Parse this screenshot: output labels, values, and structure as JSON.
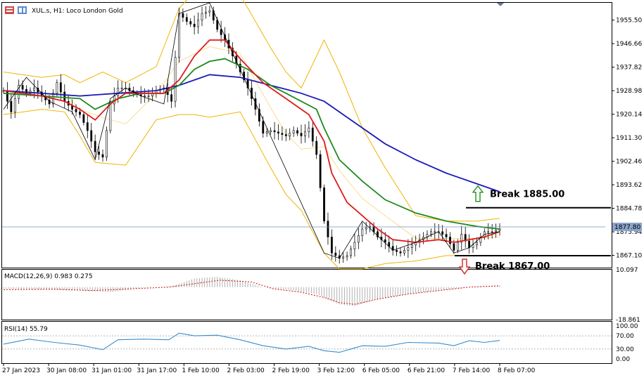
{
  "header": {
    "symbol_text": "XUL.s, H1:  Loco London Gold",
    "colors": {
      "candle_up": "#000000",
      "candle_down": "#000000",
      "ma_blue": "#1a1ab8",
      "ma_green": "#1e8a1e",
      "ma_red": "#e01a1a",
      "bollinger": "#f0b400",
      "zigzag": "#000000",
      "current_price_line": "#7090c0",
      "macd_hist": "#b0b0b0",
      "macd_signal": "#d01010",
      "rsi": "#3a8ccc"
    }
  },
  "chart_data": [
    {
      "type": "line",
      "panel": "price",
      "ylim": [
        1862.5,
        1962.0
      ],
      "y_ticks": [
        "1955.50",
        "1946.66",
        "1937.82",
        "1928.98",
        "1920.14",
        "1911.30",
        "1902.46",
        "1893.62",
        "1884.78",
        "1875.94",
        "1867.10"
      ],
      "current_price": "1877.80",
      "x_tick_labels": [
        "27 Jan 2023",
        "30 Jan 08:00",
        "31 Jan 01:00",
        "31 Jan 17:00",
        "1 Feb 10:00",
        "2 Feb 03:00",
        "2 Feb 19:00",
        "3 Feb 12:00",
        "6 Feb 05:00",
        "6 Feb 21:00",
        "7 Feb 14:00",
        "8 Feb 07:00"
      ],
      "close_path": [
        [
          0,
          1929
        ],
        [
          6,
          1921
        ],
        [
          12,
          1931
        ],
        [
          18,
          1928
        ],
        [
          24,
          1930
        ],
        [
          30,
          1927
        ],
        [
          36,
          1924
        ],
        [
          42,
          1932
        ],
        [
          48,
          1925
        ],
        [
          54,
          1922
        ],
        [
          60,
          1920
        ],
        [
          66,
          1914
        ],
        [
          72,
          1906
        ],
        [
          78,
          1904
        ],
        [
          84,
          1924
        ],
        [
          90,
          1930
        ],
        [
          96,
          1930
        ],
        [
          102,
          1928
        ],
        [
          108,
          1927
        ],
        [
          114,
          1927
        ],
        [
          120,
          1929
        ],
        [
          126,
          1930
        ],
        [
          132,
          1925
        ],
        [
          138,
          1958
        ],
        [
          144,
          1955
        ],
        [
          150,
          1953
        ],
        [
          156,
          1958
        ],
        [
          162,
          1959
        ],
        [
          168,
          1952
        ],
        [
          174,
          1948
        ],
        [
          180,
          1942
        ],
        [
          186,
          1936
        ],
        [
          192,
          1930
        ],
        [
          198,
          1922
        ],
        [
          204,
          1913
        ],
        [
          210,
          1914
        ],
        [
          216,
          1913
        ],
        [
          222,
          1912
        ],
        [
          228,
          1914
        ],
        [
          234,
          1912
        ],
        [
          240,
          1915
        ],
        [
          246,
          1905
        ],
        [
          252,
          1880
        ],
        [
          258,
          1868
        ],
        [
          264,
          1866
        ],
        [
          270,
          1867
        ],
        [
          276,
          1872
        ],
        [
          282,
          1877
        ],
        [
          288,
          1878
        ],
        [
          294,
          1874
        ],
        [
          300,
          1872
        ],
        [
          306,
          1869
        ],
        [
          312,
          1868
        ],
        [
          318,
          1870
        ],
        [
          324,
          1872
        ],
        [
          330,
          1874
        ],
        [
          336,
          1876
        ],
        [
          342,
          1876
        ],
        [
          348,
          1874
        ],
        [
          354,
          1869
        ],
        [
          360,
          1875
        ],
        [
          366,
          1870
        ],
        [
          372,
          1872
        ],
        [
          378,
          1876
        ],
        [
          384,
          1876
        ],
        [
          390,
          1877
        ]
      ],
      "zigzag": [
        [
          0,
          1922
        ],
        [
          18,
          1934
        ],
        [
          36,
          1925
        ],
        [
          54,
          1921
        ],
        [
          72,
          1903
        ],
        [
          84,
          1926
        ],
        [
          96,
          1930
        ],
        [
          108,
          1927
        ],
        [
          126,
          1924
        ],
        [
          138,
          1958
        ],
        [
          162,
          1962
        ],
        [
          252,
          1868
        ],
        [
          264,
          1866
        ],
        [
          282,
          1880
        ],
        [
          306,
          1869
        ],
        [
          324,
          1872
        ],
        [
          342,
          1876
        ],
        [
          354,
          1868
        ],
        [
          366,
          1870
        ],
        [
          378,
          1875
        ],
        [
          390,
          1876
        ]
      ],
      "series": [
        {
          "key": "ma_blue",
          "values": [
            [
              0,
              1929
            ],
            [
              30,
              1928
            ],
            [
              60,
              1927
            ],
            [
              90,
              1928
            ],
            [
              120,
              1929
            ],
            [
              138,
              1931
            ],
            [
              162,
              1935
            ],
            [
              186,
              1934
            ],
            [
              210,
              1931
            ],
            [
              234,
              1928
            ],
            [
              252,
              1925
            ],
            [
              276,
              1917
            ],
            [
              300,
              1909
            ],
            [
              324,
              1903
            ],
            [
              348,
              1898
            ],
            [
              372,
              1894
            ],
            [
              390,
              1891
            ]
          ]
        },
        {
          "key": "ma_green",
          "values": [
            [
              0,
              1928
            ],
            [
              30,
              1927
            ],
            [
              60,
              1926
            ],
            [
              72,
              1922
            ],
            [
              90,
              1926
            ],
            [
              108,
              1928
            ],
            [
              126,
              1928
            ],
            [
              138,
              1931
            ],
            [
              150,
              1937
            ],
            [
              162,
              1940
            ],
            [
              174,
              1941
            ],
            [
              192,
              1937
            ],
            [
              210,
              1931
            ],
            [
              234,
              1925
            ],
            [
              246,
              1922
            ],
            [
              252,
              1915
            ],
            [
              264,
              1903
            ],
            [
              282,
              1895
            ],
            [
              300,
              1888
            ],
            [
              324,
              1883
            ],
            [
              348,
              1880
            ],
            [
              372,
              1878
            ],
            [
              390,
              1877
            ]
          ]
        },
        {
          "key": "ma_red",
          "values": [
            [
              0,
              1929
            ],
            [
              30,
              1927
            ],
            [
              48,
              1925
            ],
            [
              60,
              1922
            ],
            [
              72,
              1918
            ],
            [
              84,
              1924
            ],
            [
              96,
              1928
            ],
            [
              108,
              1928
            ],
            [
              126,
              1928
            ],
            [
              138,
              1933
            ],
            [
              150,
              1942
            ],
            [
              162,
              1948
            ],
            [
              174,
              1948
            ],
            [
              186,
              1941
            ],
            [
              204,
              1932
            ],
            [
              222,
              1926
            ],
            [
              240,
              1920
            ],
            [
              252,
              1910
            ],
            [
              258,
              1898
            ],
            [
              270,
              1887
            ],
            [
              282,
              1882
            ],
            [
              294,
              1877
            ],
            [
              306,
              1873
            ],
            [
              324,
              1872
            ],
            [
              342,
              1873
            ],
            [
              354,
              1872
            ],
            [
              366,
              1873
            ],
            [
              378,
              1874
            ],
            [
              390,
              1876
            ]
          ]
        },
        {
          "key": "bb_upper",
          "values": [
            [
              0,
              1936
            ],
            [
              30,
              1934
            ],
            [
              48,
              1935
            ],
            [
              60,
              1932
            ],
            [
              78,
              1936
            ],
            [
              96,
              1932
            ],
            [
              120,
              1938
            ],
            [
              138,
              1960
            ],
            [
              162,
              1972
            ],
            [
              186,
              1965
            ],
            [
              210,
              1945
            ],
            [
              222,
              1936
            ],
            [
              234,
              1930
            ],
            [
              246,
              1942
            ],
            [
              252,
              1948
            ],
            [
              264,
              1936
            ],
            [
              282,
              1915
            ],
            [
              300,
              1900
            ],
            [
              324,
              1882
            ],
            [
              348,
              1880
            ],
            [
              372,
              1880
            ],
            [
              390,
              1881
            ]
          ]
        },
        {
          "key": "bb_lower",
          "values": [
            [
              0,
              1920
            ],
            [
              30,
              1922
            ],
            [
              48,
              1921
            ],
            [
              60,
              1912
            ],
            [
              72,
              1902
            ],
            [
              96,
              1901
            ],
            [
              120,
              1918
            ],
            [
              138,
              1920
            ],
            [
              150,
              1920
            ],
            [
              162,
              1919
            ],
            [
              186,
              1921
            ],
            [
              210,
              1900
            ],
            [
              222,
              1890
            ],
            [
              234,
              1884
            ],
            [
              252,
              1868
            ],
            [
              264,
              1862
            ],
            [
              282,
              1862
            ],
            [
              300,
              1864
            ],
            [
              324,
              1865
            ],
            [
              348,
              1867
            ],
            [
              372,
              1867
            ],
            [
              390,
              1867
            ]
          ]
        }
      ],
      "annotations": [
        {
          "text": "Break 1885.00",
          "level": 1885.0,
          "direction": "up"
        },
        {
          "text": "Break 1867.00",
          "level": 1867.0,
          "direction": "down"
        }
      ]
    },
    {
      "type": "bar",
      "panel": "macd",
      "label": "MACD(12,26,9) 0.983 0.275",
      "ylim": [
        -18.861,
        10.097
      ],
      "y_ticks": [
        "10.097",
        "-18.861"
      ],
      "hist": [
        [
          0,
          -1
        ],
        [
          30,
          -1.5
        ],
        [
          60,
          -2
        ],
        [
          84,
          -3
        ],
        [
          108,
          -0.5
        ],
        [
          132,
          0.5
        ],
        [
          150,
          5
        ],
        [
          168,
          6
        ],
        [
          186,
          4
        ],
        [
          204,
          0
        ],
        [
          228,
          -2
        ],
        [
          246,
          -4
        ],
        [
          264,
          -10
        ],
        [
          276,
          -11
        ],
        [
          294,
          -7
        ],
        [
          318,
          -4
        ],
        [
          342,
          -2
        ],
        [
          366,
          0
        ],
        [
          390,
          1
        ]
      ],
      "signal": [
        [
          0,
          -1.5
        ],
        [
          40,
          -1.2
        ],
        [
          70,
          -2
        ],
        [
          100,
          -1
        ],
        [
          130,
          0
        ],
        [
          150,
          2
        ],
        [
          170,
          4
        ],
        [
          195,
          3
        ],
        [
          212,
          -1
        ],
        [
          234,
          -3
        ],
        [
          252,
          -6
        ],
        [
          264,
          -9
        ],
        [
          276,
          -10
        ],
        [
          294,
          -7
        ],
        [
          318,
          -4
        ],
        [
          342,
          -2
        ],
        [
          366,
          0
        ],
        [
          390,
          0.8
        ]
      ]
    },
    {
      "type": "line",
      "panel": "rsi",
      "label": "RSI(14) 55.79",
      "ylim": [
        0,
        100
      ],
      "y_ticks": [
        "100.00",
        "70.00",
        "30.00",
        "0.00"
      ],
      "values": [
        [
          0,
          45
        ],
        [
          20,
          60
        ],
        [
          40,
          50
        ],
        [
          60,
          42
        ],
        [
          78,
          28
        ],
        [
          90,
          58
        ],
        [
          110,
          60
        ],
        [
          130,
          58
        ],
        [
          138,
          78
        ],
        [
          150,
          70
        ],
        [
          168,
          72
        ],
        [
          186,
          58
        ],
        [
          204,
          40
        ],
        [
          222,
          30
        ],
        [
          240,
          38
        ],
        [
          252,
          25
        ],
        [
          264,
          20
        ],
        [
          282,
          40
        ],
        [
          300,
          38
        ],
        [
          318,
          50
        ],
        [
          342,
          48
        ],
        [
          354,
          40
        ],
        [
          366,
          55
        ],
        [
          378,
          50
        ],
        [
          390,
          56
        ]
      ]
    }
  ]
}
